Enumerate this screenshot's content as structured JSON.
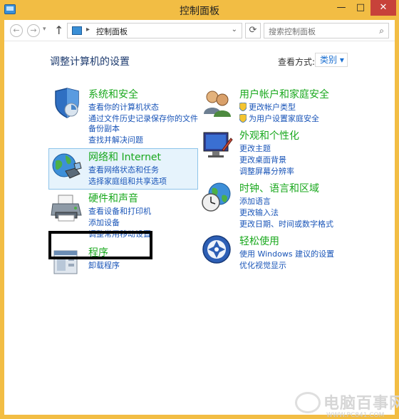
{
  "window": {
    "title": "控制面板",
    "minimize": "—",
    "maximize": "□",
    "close": "✕"
  },
  "toolbar": {
    "back": "←",
    "forward": "→",
    "recent": "▾",
    "up": "↑",
    "breadcrumb": "控制面板",
    "breadcrumb_sep": "▸",
    "address_dropdown": "⌄",
    "refresh": "⟳",
    "search_placeholder": "搜索控制面板",
    "search_icon": "⌕"
  },
  "main": {
    "heading": "调整计算机的设置",
    "view_by_label": "查看方式:",
    "view_by_value": "类别 ▾"
  },
  "categories": [
    {
      "id": "system-security",
      "icon": "shield-icon",
      "title": "系统和安全",
      "links": [
        "查看你的计算机状态",
        "通过文件历史记录保存你的文件",
        "备份副本",
        "查找并解决问题"
      ]
    },
    {
      "id": "network-internet",
      "icon": "globe-network-icon",
      "title": "网络和 Internet",
      "links": [
        "查看网络状态和任务",
        "选择家庭组和共享选项"
      ]
    },
    {
      "id": "hardware-sound",
      "icon": "printer-icon",
      "title": "硬件和声音",
      "links": [
        "查看设备和打印机",
        "添加设备",
        "调整常用移动设置"
      ]
    },
    {
      "id": "programs",
      "icon": "programs-icon",
      "title": "程序",
      "links": [
        "卸载程序"
      ]
    },
    {
      "id": "user-accounts",
      "icon": "users-icon",
      "title": "用户帐户和家庭安全",
      "links": [
        "更改帐户类型",
        "为用户设置家庭安全"
      ]
    },
    {
      "id": "appearance",
      "icon": "monitor-brush-icon",
      "title": "外观和个性化",
      "links": [
        "更改主题",
        "更改桌面背景",
        "调整屏幕分辨率"
      ]
    },
    {
      "id": "clock-language",
      "icon": "globe-clock-icon",
      "title": "时钟、语言和区域",
      "links": [
        "添加语言",
        "更改输入法",
        "更改日期、时间或数字格式"
      ]
    },
    {
      "id": "ease-of-access",
      "icon": "ease-access-icon",
      "title": "轻松使用",
      "links": [
        "使用 Windows 建议的设置",
        "优化视觉显示"
      ]
    }
  ],
  "watermark": {
    "text": "电脑百事网",
    "url": "WWW.PC841.COM"
  },
  "colors": {
    "title_bar": "#f2bd44",
    "close_button": "#c7423a",
    "category_title": "#19a81d",
    "link": "#1a55b8",
    "heading": "#1c3a6e"
  }
}
